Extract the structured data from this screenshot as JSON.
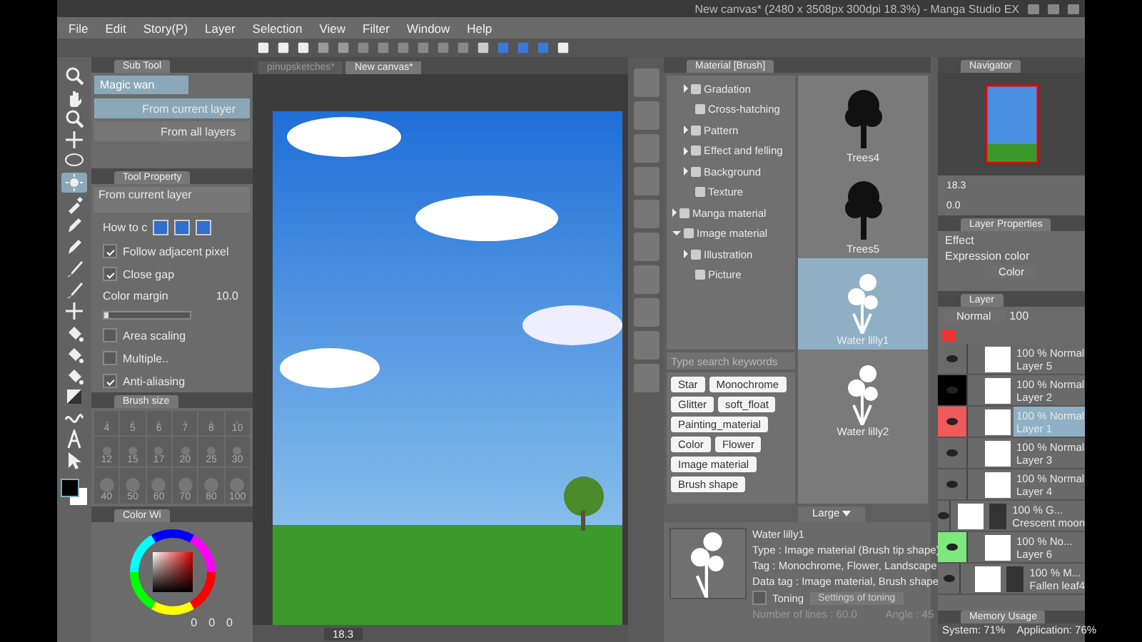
{
  "window": {
    "title": "New canvas* (2480 x 3508px 300dpi 18.3%) - Manga Studio EX"
  },
  "menu": [
    "File",
    "Edit",
    "Story(P)",
    "Layer",
    "Selection",
    "View",
    "Filter",
    "Window",
    "Help"
  ],
  "tools": [
    {
      "kind": "zoom",
      "selected": false
    },
    {
      "kind": "hand",
      "selected": false
    },
    {
      "kind": "zoom",
      "selected": false
    },
    {
      "kind": "move",
      "selected": false
    },
    {
      "kind": "lasso",
      "selected": false
    },
    {
      "kind": "wand",
      "selected": true
    },
    {
      "kind": "dropper",
      "selected": false
    },
    {
      "kind": "pen",
      "selected": false
    },
    {
      "kind": "pen",
      "selected": false
    },
    {
      "kind": "brush",
      "selected": false
    },
    {
      "kind": "brush",
      "selected": false
    },
    {
      "kind": "move",
      "selected": false
    },
    {
      "kind": "fill",
      "selected": false
    },
    {
      "kind": "fill",
      "selected": false
    },
    {
      "kind": "fill",
      "selected": false
    },
    {
      "kind": "gradient",
      "selected": false
    },
    {
      "kind": "curve",
      "selected": false
    },
    {
      "kind": "text",
      "selected": false
    },
    {
      "kind": "pointer",
      "selected": false
    }
  ],
  "sub_tool": {
    "tab": "Sub Tool",
    "group": "Magic wan",
    "items": [
      {
        "label": "From current layer",
        "selected": true
      },
      {
        "label": "From all layers",
        "selected": false
      }
    ]
  },
  "tool_property": {
    "tab": "Tool Property",
    "tool_name": "From current layer",
    "how_to": "How to c",
    "follow": {
      "label": "Follow adjacent pixel",
      "checked": true
    },
    "close_gap": {
      "label": "Close gap",
      "checked": true
    },
    "margin": {
      "label": "Color margin",
      "value": "10.0",
      "level": 0.05
    },
    "area": {
      "label": "Area scaling",
      "checked": false
    },
    "multiple": {
      "label": "Multiple..",
      "checked": false
    },
    "anti": {
      "label": "Anti-aliasing",
      "checked": true
    }
  },
  "brush_size": {
    "tab": "Brush size",
    "sizes": [
      "4",
      "5",
      "6",
      "7",
      "8",
      "10",
      "12",
      "15",
      "17",
      "20",
      "25",
      "30",
      "40",
      "50",
      "60",
      "70",
      "80",
      "100"
    ]
  },
  "color_wheel": {
    "tab": "Color Wi",
    "readouts": [
      "0",
      "0",
      "0"
    ]
  },
  "canvas": {
    "tabs": [
      {
        "label": "pinupsketches*",
        "selected": false
      },
      {
        "label": "New canvas*",
        "selected": true
      }
    ],
    "zoom": "18.3"
  },
  "material": {
    "tab": "Material [Brush]",
    "tree": [
      {
        "expanded": true,
        "children": [
          {
            "label": "Gradation",
            "expanded": false
          },
          {
            "label": "Cross-hatching"
          },
          {
            "label": "Pattern",
            "expanded": false
          },
          {
            "label": "Effect and felling",
            "expanded": false
          },
          {
            "label": "Background",
            "expanded": false
          },
          {
            "label": "Texture"
          }
        ]
      },
      {
        "label": "Manga material",
        "expanded": false
      },
      {
        "label": "Image material",
        "expanded": true,
        "children": [
          {
            "label": "Illustration",
            "expanded": false
          },
          {
            "label": "Picture"
          }
        ]
      }
    ],
    "search": {
      "placeholder": "Type search keywords"
    },
    "tags": [
      "Star",
      "Monochrome",
      "Glitter",
      "soft_float",
      "Painting_material",
      "Color",
      "Flower",
      "Image material",
      "Brush shape"
    ],
    "thumbnails": [
      {
        "label": "Trees4",
        "kind": "tree",
        "selected": false
      },
      {
        "label": "Trees5",
        "kind": "tree",
        "selected": false
      },
      {
        "label": "Water lilly1",
        "kind": "flower",
        "selected": true
      },
      {
        "label": "Water lilly2",
        "kind": "flower",
        "selected": false
      }
    ],
    "size": "Large",
    "detail": {
      "name": "Water lilly1",
      "type": "Type : Image material (Brush tip shape)",
      "tag": "Tag : Monochrome, Flower, Landscape",
      "data_tag": "Data tag : Image material, Brush shape",
      "toning": {
        "label": "Toning",
        "checked": false
      },
      "toning_button": {
        "label": "Settings of toning",
        "disabled": true
      },
      "lines": "Number of lines : 60.0",
      "angle": "Angle : 45"
    }
  },
  "navigator": {
    "tab": "Navigator",
    "zoom": "18.3",
    "rotation": "0.0"
  },
  "layer_properties": {
    "tab": "Layer Properties",
    "effect": "Effect",
    "expression": "Expression color",
    "expression_value": "Color"
  },
  "layers": {
    "tab": "Layer",
    "blend": "Normal",
    "opacity": "100",
    "items": [
      {
        "opacity": "100 %",
        "blend": "Normal",
        "name": "Layer 5",
        "selected": false,
        "mask": false
      },
      {
        "opacity": "100 %",
        "blend": "Normal",
        "name": "Layer 2",
        "selected": false,
        "mask": false,
        "color": "#000000"
      },
      {
        "opacity": "100 %",
        "blend": "Normal",
        "name": "Layer 1",
        "selected": true,
        "mask": false,
        "color": "#f05a5a"
      },
      {
        "opacity": "100 %",
        "blend": "Normal",
        "name": "Layer 3",
        "selected": false,
        "mask": false
      },
      {
        "opacity": "100 %",
        "blend": "Normal",
        "name": "Layer 4",
        "selected": false,
        "mask": false
      },
      {
        "opacity": "100 %",
        "blend": "G...",
        "name": "Crescent moon",
        "selected": false,
        "mask": true
      },
      {
        "opacity": "100 %",
        "blend": "No...",
        "name": "Layer 6",
        "selected": false,
        "mask": false,
        "color": "#7ee87e"
      },
      {
        "opacity": "100 %",
        "blend": "M...",
        "name": "Fallen leaf4",
        "selected": false,
        "mask": true
      }
    ]
  },
  "memory": {
    "tab": "Memory Usage",
    "system": "System: 71%",
    "application": "Application: 76%"
  }
}
